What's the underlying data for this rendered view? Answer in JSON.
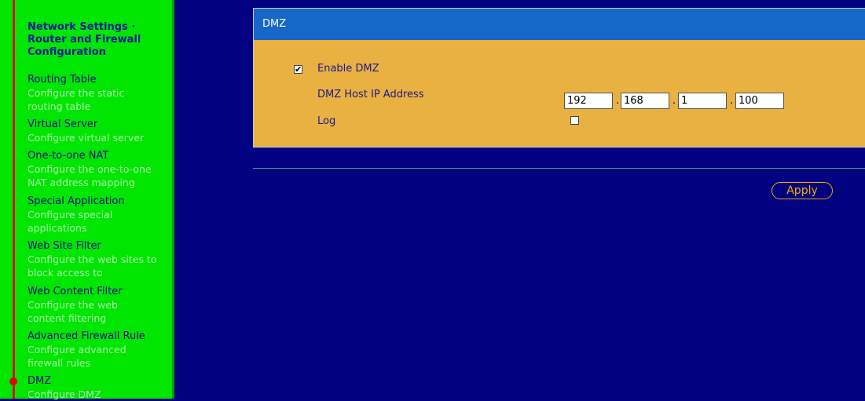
{
  "sidebar": {
    "title": "Network Settings · Router and Firewall Configuration",
    "items": [
      {
        "label": "Routing Table",
        "desc": "Configure the static routing table"
      },
      {
        "label": "Virtual Server",
        "desc": "Configure virtual server"
      },
      {
        "label": "One-to-one NAT",
        "desc": "Configure the one-to-one NAT address mapping"
      },
      {
        "label": "Special Application",
        "desc": "Configure special applications"
      },
      {
        "label": "Web Site Filter",
        "desc": "Configure the web sites to block access to"
      },
      {
        "label": "Web Content Filter",
        "desc": "Configure the web content filtering"
      },
      {
        "label": "Advanced Firewall Rule",
        "desc": "Configure advanced firewall rules"
      },
      {
        "label": "DMZ",
        "desc": "Configure DMZ"
      }
    ],
    "active": "DMZ"
  },
  "panel": {
    "title": "DMZ",
    "enable_label": "Enable DMZ",
    "enable_checked": "✔",
    "host_ip_label": "DMZ Host IP Address",
    "ip": [
      "192",
      "168",
      "1",
      "100"
    ],
    "ip_separator": ".",
    "log_label": "Log",
    "log_checked": ""
  },
  "actions": {
    "apply_label": "Apply"
  },
  "colors": {
    "sidebar_bg": "#00e600",
    "page_bg": "#000080",
    "panel_bg": "#e9b042",
    "header_bg": "#1667c8",
    "active_marker": "#e00000"
  }
}
